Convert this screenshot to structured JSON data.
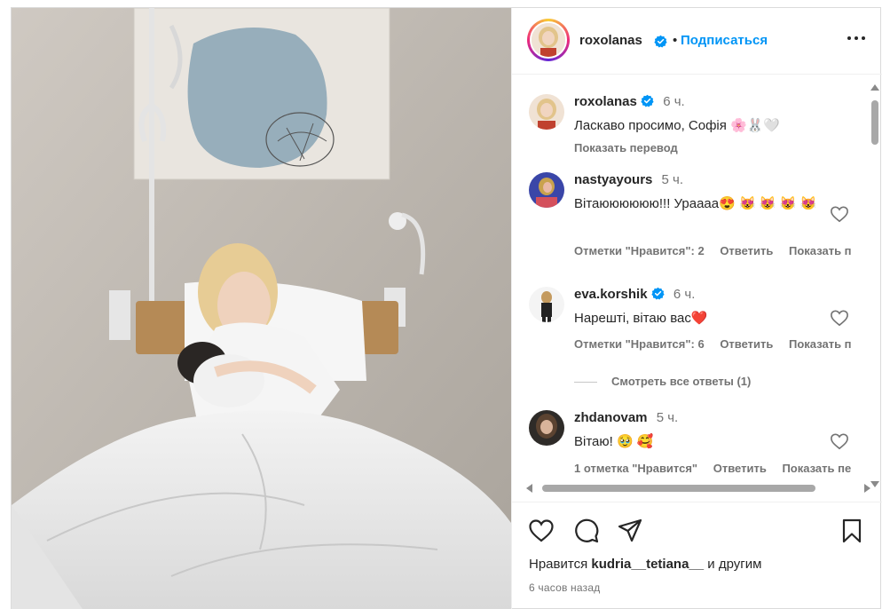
{
  "post": {
    "author": "roxolanas",
    "follow_label": "Подписаться",
    "dot": "•",
    "more_icon": "more-horizontal-icon"
  },
  "comments": [
    {
      "user": "roxolanas",
      "verified": true,
      "time": "6 ч.",
      "text": "Ласкаво просимо, Софія 🌸🐰🤍",
      "translate_label": "Показать перевод"
    },
    {
      "user": "nastyayours",
      "verified": false,
      "time": "5 ч.",
      "text": "Вітаюююююю!!! Урaааа😍 😻 😻 😻 😻",
      "likes_label": "Отметки \"Нравится\": 2",
      "reply_label": "Ответить",
      "translate_label": "Показать п"
    },
    {
      "user": "eva.korshik",
      "verified": true,
      "time": "6 ч.",
      "text": "Нарешті, вітаю вас❤️",
      "likes_label": "Отметки \"Нравится\": 6",
      "reply_label": "Ответить",
      "translate_label": "Показать п"
    },
    {
      "user": "zhdanovam",
      "verified": false,
      "time": "5 ч.",
      "text": "Вітаю! 🥹 🥰",
      "likes_label": "1 отметка \"Нравится\"",
      "reply_label": "Ответить",
      "translate_label": "Показать пе"
    }
  ],
  "view_replies_label": "Смотреть все ответы (1)",
  "footer": {
    "likes_prefix": "Нравится",
    "likes_user": "kudria__tetiana__",
    "likes_suffix": "и другим",
    "timestamp": "6 часов назад"
  },
  "colors": {
    "accent": "#0095f6",
    "verified": "#0095f6",
    "secondary_text": "#737373"
  }
}
